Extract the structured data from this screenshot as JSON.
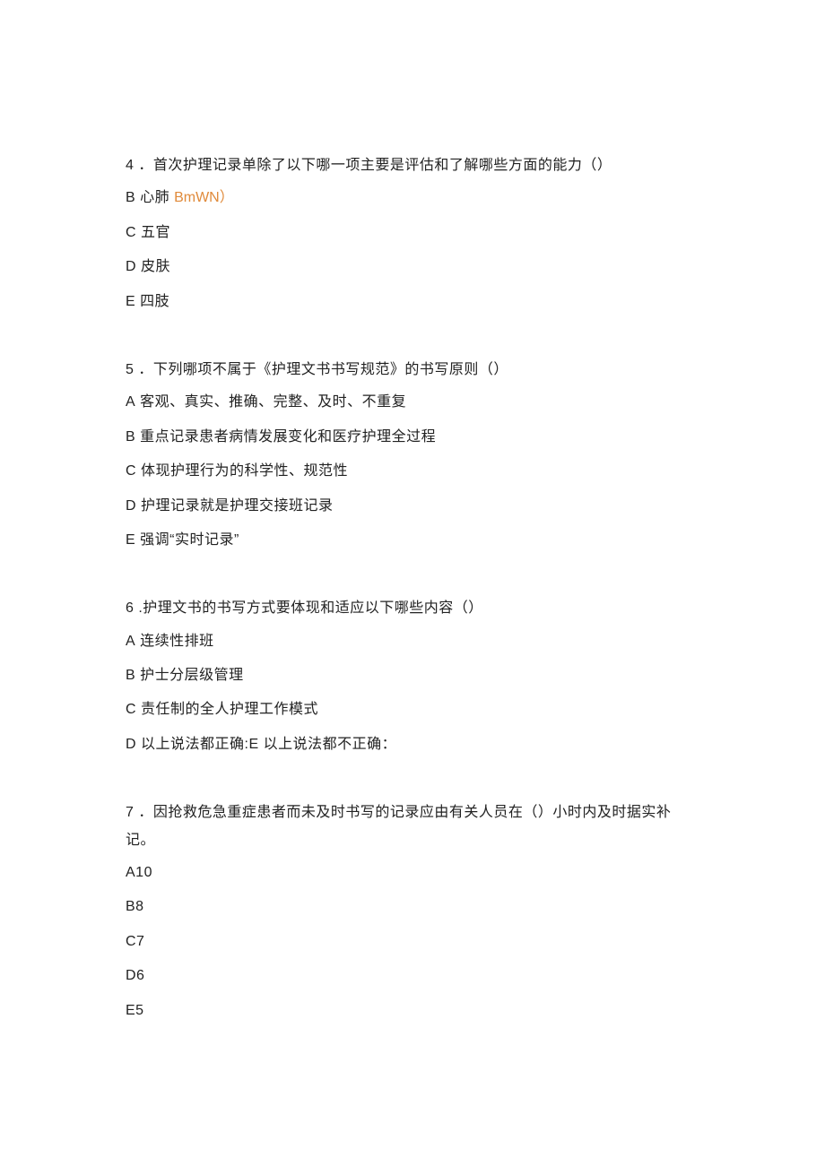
{
  "questions": [
    {
      "number": "4",
      "stem_prefix": " ．",
      "stem": "首次护理记录单除了以下哪一项主要是评估和了解哪些方面的能力（）",
      "options": [
        {
          "label": "B",
          "text": " 心肺 ",
          "tail_code": "BmWN）"
        },
        {
          "label": "C",
          "text": " 五官"
        },
        {
          "label": "D",
          "text": " 皮肤"
        },
        {
          "label": "E",
          "text": " 四肢"
        }
      ]
    },
    {
      "number": "5",
      "stem_prefix": " ．",
      "stem": "下列哪项不属于《护理文书书写规范》的书写原则（）",
      "options": [
        {
          "label": "A",
          "text": " 客观、真实、推确、完整、及时、不重复"
        },
        {
          "label": "B",
          "text": " 重点记录患者病情发展变化和医疗护理全过程"
        },
        {
          "label": "C",
          "text": " 体现护理行为的科学性、规范性"
        },
        {
          "label": "D",
          "text": " 护理记录就是护理交接班记录"
        },
        {
          "label": "E",
          "text": " 强调“实时记录”"
        }
      ]
    },
    {
      "number": "6",
      "stem_prefix": "  .",
      "stem": "护理文书的书写方式要体现和适应以下哪些内容（）",
      "options": [
        {
          "label": "A",
          "text": " 连续性排班"
        },
        {
          "label": "B",
          "text": " 护士分层级管理"
        },
        {
          "label": "C",
          "text": " 责任制的全人护理工作模式"
        },
        {
          "label": "D",
          "text": " 以上说法都正确:E 以上说法都不正确："
        }
      ]
    },
    {
      "number": "7",
      "stem_prefix": " ．",
      "stem": "因抢救危急重症患者而未及时书写的记录应由有关人员在（）小时内及时据实补记。",
      "options": [
        {
          "label": "A10",
          "text": ""
        },
        {
          "label": "B8",
          "text": ""
        },
        {
          "label": "C7",
          "text": ""
        },
        {
          "label": "D6",
          "text": ""
        },
        {
          "label": "E5",
          "text": ""
        }
      ]
    }
  ]
}
